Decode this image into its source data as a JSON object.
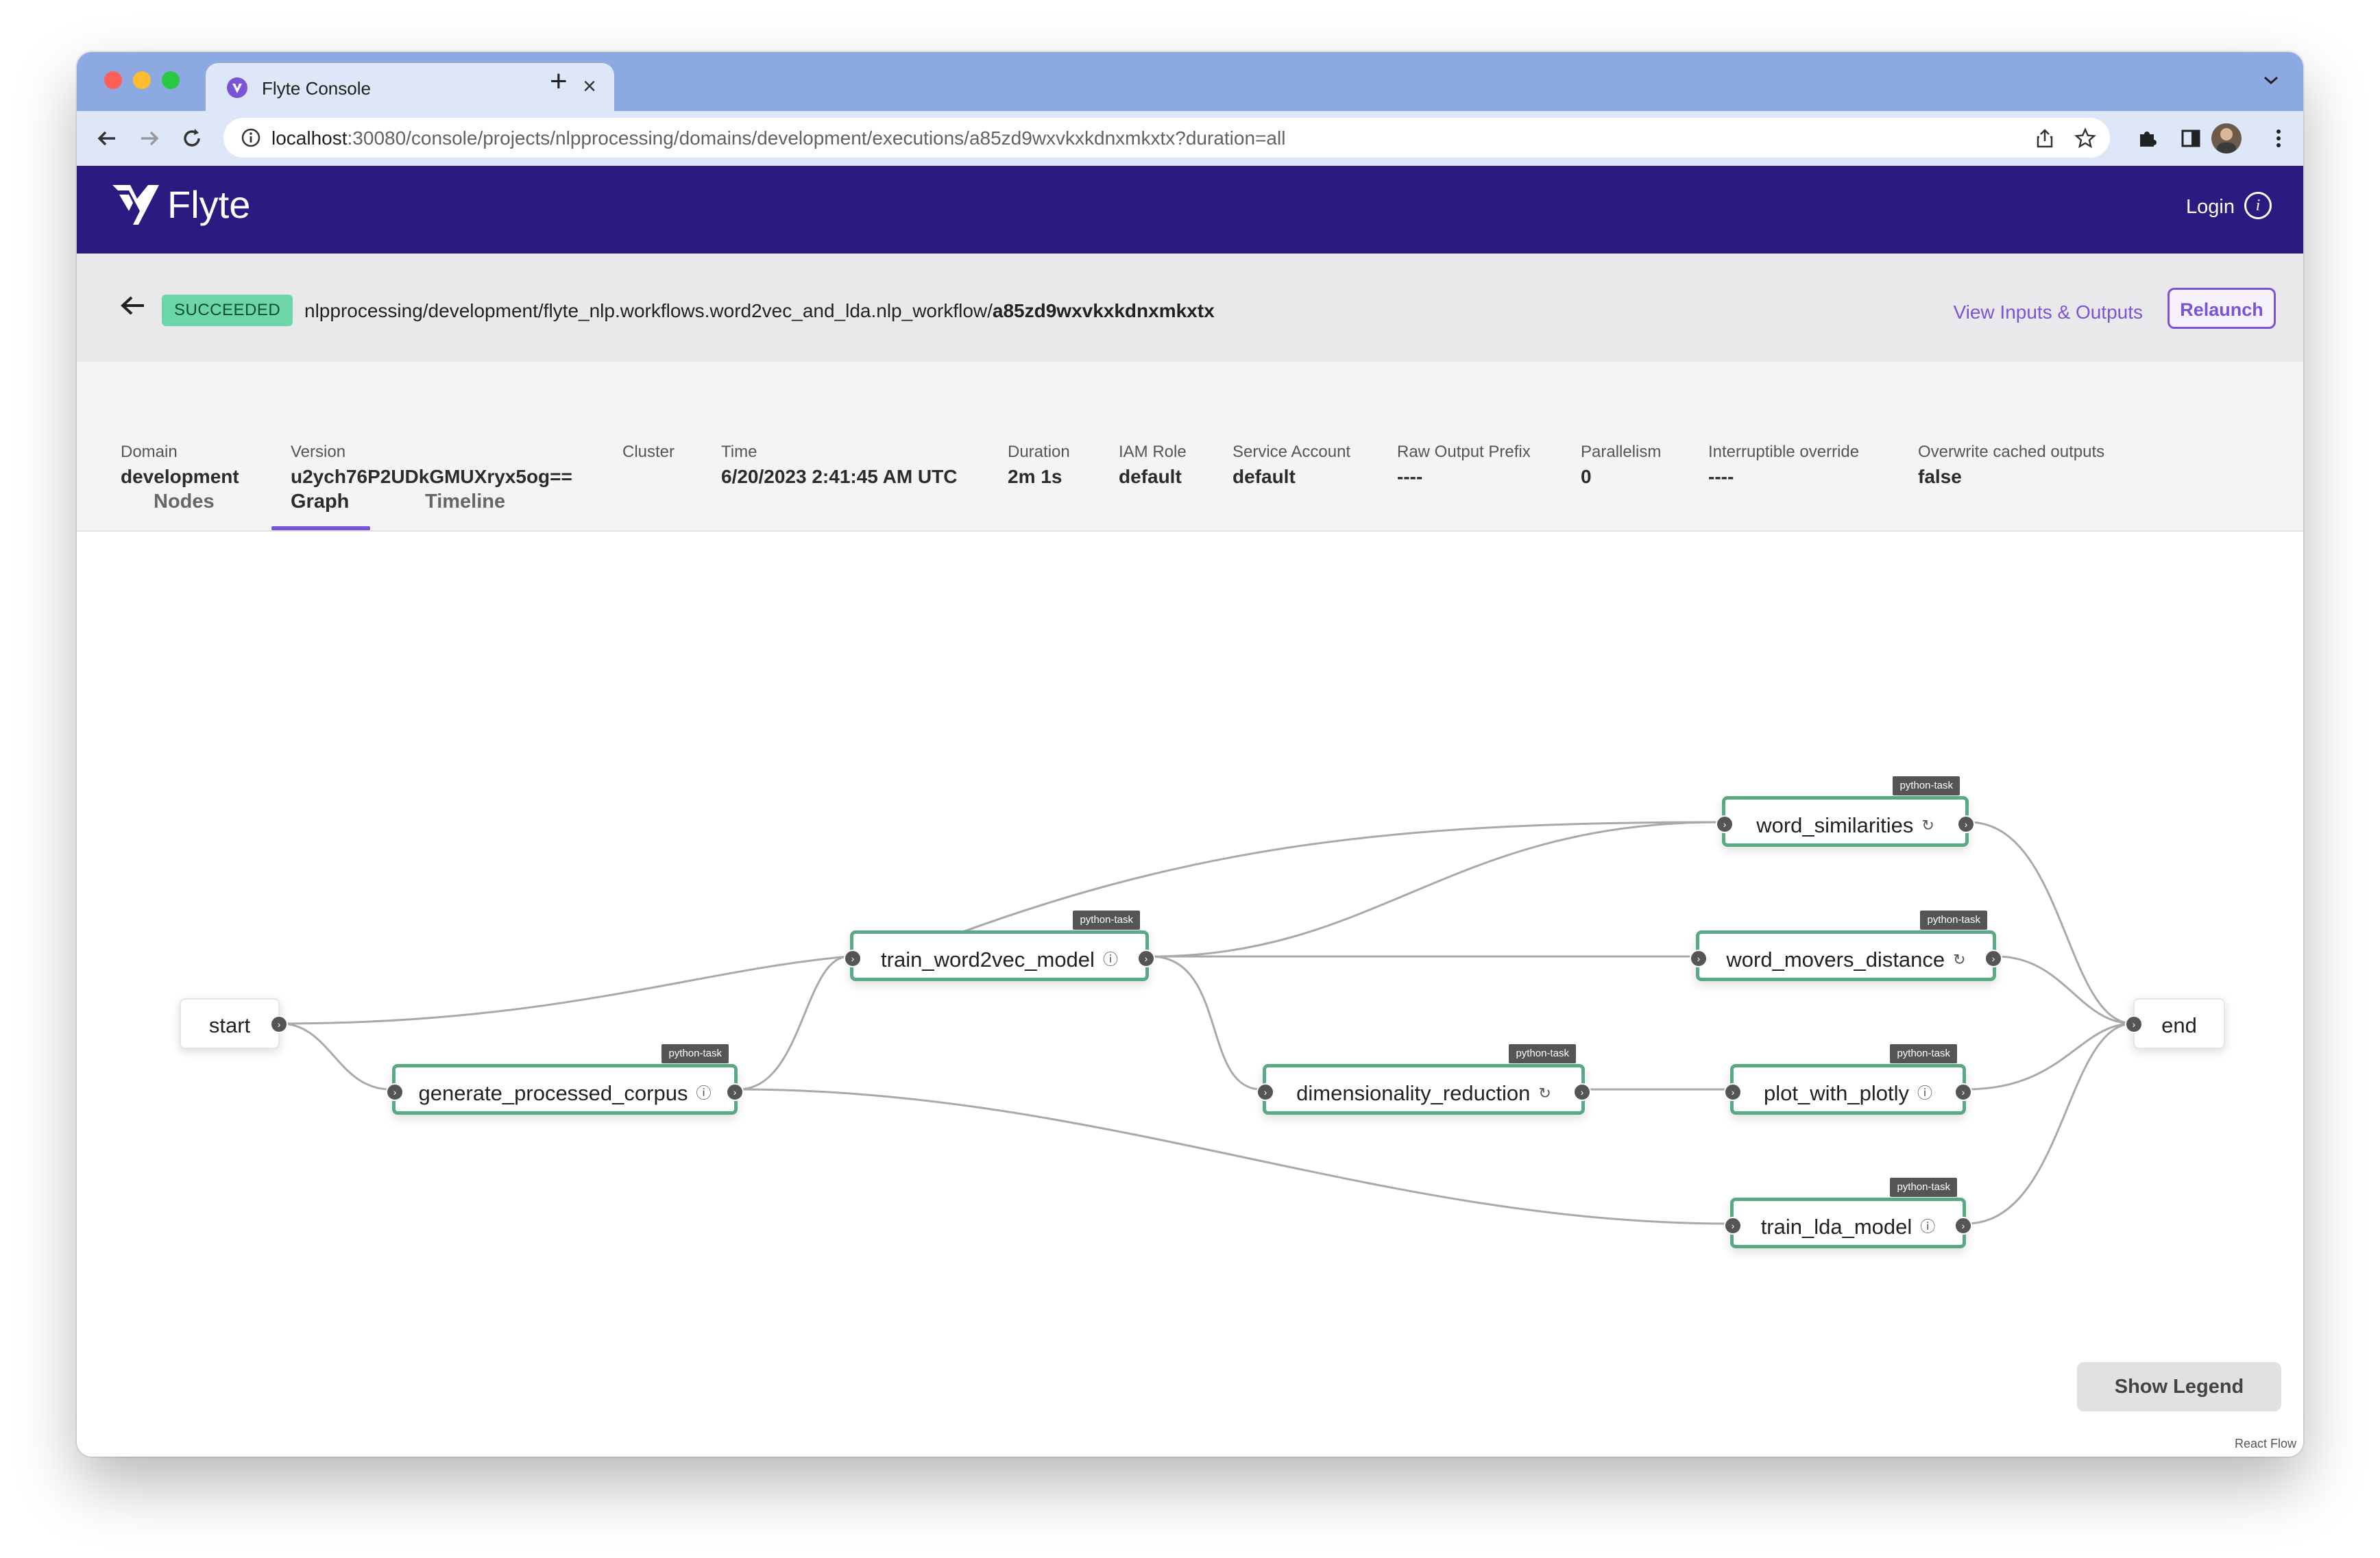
{
  "browser": {
    "tab_title": "Flyte Console",
    "url_host": "localhost",
    "url_rest": ":30080/console/projects/nlpprocessing/domains/development/executions/a85zd9wxvkxkdnxmkxtx?duration=all"
  },
  "header": {
    "logo_text": "Flyte",
    "login_label": "Login"
  },
  "execution": {
    "status": "SUCCEEDED",
    "path_prefix": "nlpprocessing/development/flyte_nlp.workflows.word2vec_and_lda.nlp_workflow/",
    "execution_id": "a85zd9wxvkxkdnxmkxtx",
    "view_io_label": "View Inputs & Outputs",
    "relaunch_label": "Relaunch",
    "status_color": "#6cd6a8"
  },
  "metadata": [
    {
      "label": "Domain",
      "value": "development"
    },
    {
      "label": "Version",
      "value": "u2ych76P2UDkGMUXryx5og=="
    },
    {
      "label": "Cluster",
      "value": ""
    },
    {
      "label": "Time",
      "value": "6/20/2023 2:41:45 AM UTC"
    },
    {
      "label": "Duration",
      "value": "2m 1s"
    },
    {
      "label": "IAM Role",
      "value": "default"
    },
    {
      "label": "Service Account",
      "value": "default"
    },
    {
      "label": "Raw Output Prefix",
      "value": "----"
    },
    {
      "label": "Parallelism",
      "value": "0"
    },
    {
      "label": "Interruptible override",
      "value": "----"
    },
    {
      "label": "Overwrite cached outputs",
      "value": "false"
    }
  ],
  "tabs": [
    {
      "label": "Nodes",
      "active": false
    },
    {
      "label": "Graph",
      "active": true
    },
    {
      "label": "Timeline",
      "active": false
    }
  ],
  "graph": {
    "nodes": {
      "start": {
        "label": "start"
      },
      "end": {
        "label": "end"
      },
      "generate_processed_corpus": {
        "label": "generate_processed_corpus",
        "type": "python-task",
        "icon": "info-icon"
      },
      "train_word2vec_model": {
        "label": "train_word2vec_model",
        "type": "python-task",
        "icon": "info-icon"
      },
      "dimensionality_reduction": {
        "label": "dimensionality_reduction",
        "type": "python-task",
        "icon": "cache-icon"
      },
      "word_similarities": {
        "label": "word_similarities",
        "type": "python-task",
        "icon": "cache-icon"
      },
      "word_movers_distance": {
        "label": "word_movers_distance",
        "type": "python-task",
        "icon": "cache-icon"
      },
      "plot_with_plotly": {
        "label": "plot_with_plotly",
        "type": "python-task",
        "icon": "info-icon"
      },
      "train_lda_model": {
        "label": "train_lda_model",
        "type": "python-task",
        "icon": "info-icon"
      }
    },
    "edges": [
      [
        "start",
        "generate_processed_corpus"
      ],
      [
        "start",
        "train_word2vec_model"
      ],
      [
        "generate_processed_corpus",
        "train_word2vec_model"
      ],
      [
        "generate_processed_corpus",
        "train_lda_model"
      ],
      [
        "train_word2vec_model",
        "word_similarities"
      ],
      [
        "train_word2vec_model",
        "word_movers_distance"
      ],
      [
        "train_word2vec_model",
        "dimensionality_reduction"
      ],
      [
        "start",
        "word_similarities"
      ],
      [
        "dimensionality_reduction",
        "plot_with_plotly"
      ],
      [
        "word_similarities",
        "end"
      ],
      [
        "word_movers_distance",
        "end"
      ],
      [
        "plot_with_plotly",
        "end"
      ],
      [
        "train_lda_model",
        "end"
      ]
    ],
    "node_border_color": "#5aa985",
    "show_legend_label": "Show Legend",
    "attribution": "React Flow"
  }
}
